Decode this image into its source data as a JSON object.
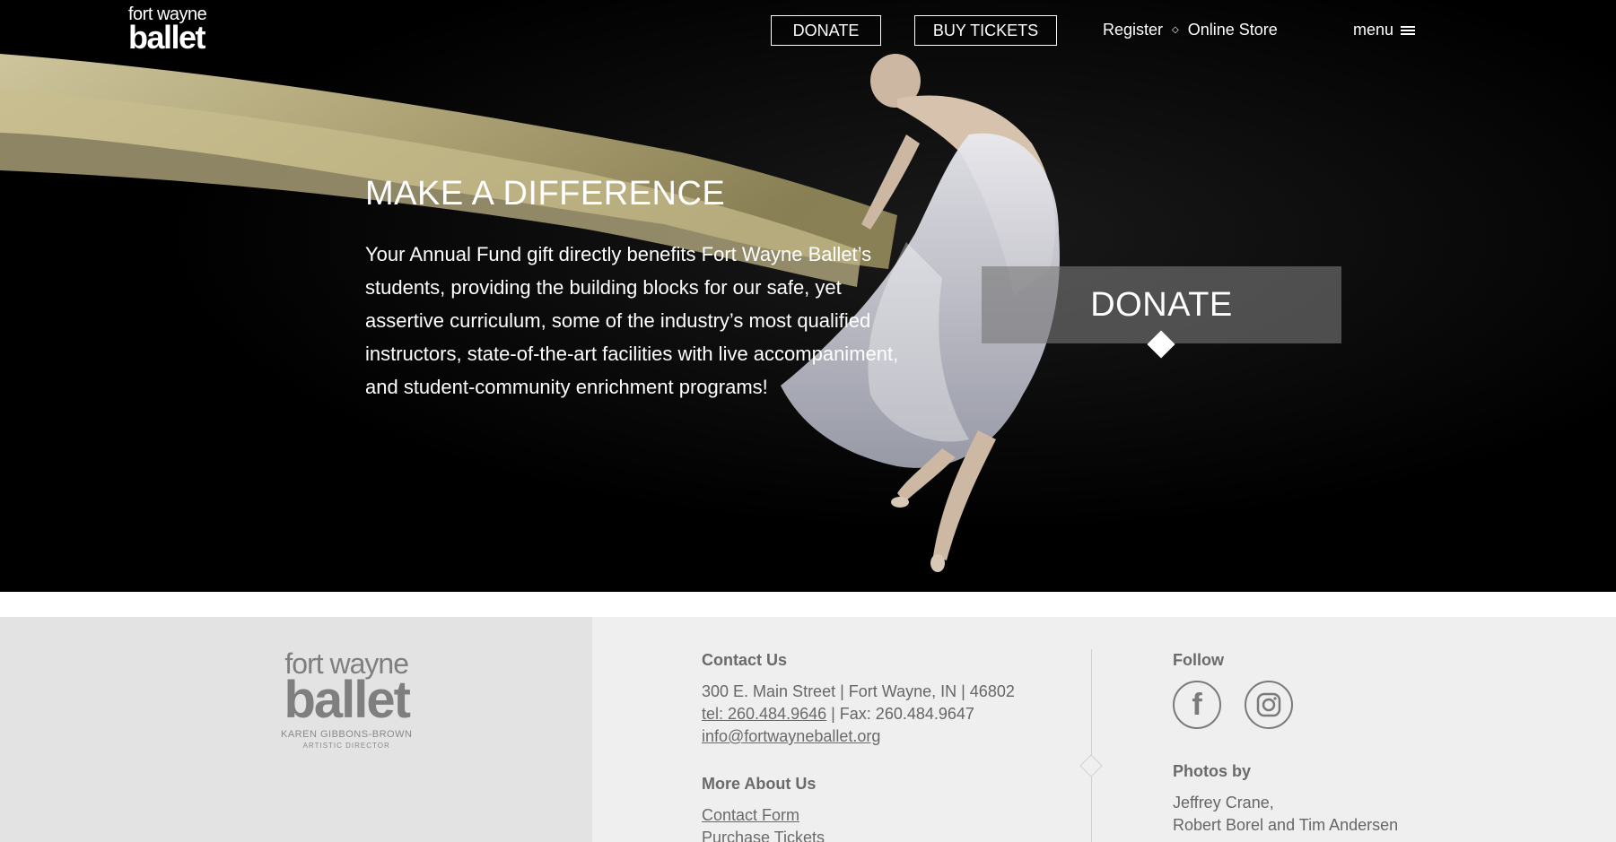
{
  "header": {
    "logo_small": "fort wayne",
    "logo_big": "ballet",
    "donate": "DONATE",
    "buy_tickets": "BUY TICKETS",
    "register": "Register",
    "separator": "◇",
    "online_store": "Online Store",
    "menu": "menu"
  },
  "hero": {
    "title": "MAKE A DIFFERENCE",
    "text": "Your Annual Fund gift directly benefits Fort Wayne Ballet’s students, providing the building blocks for our safe, yet assertive curriculum, some of the industry’s most qualified instructors, state-of-the-art facilities with live accompaniment, and student-community enrichment programs!",
    "donate_button": "DONATE"
  },
  "footer": {
    "logo_small": "fort wayne",
    "logo_big": "ballet",
    "logo_director": "KAREN GIBBONS-BROWN",
    "logo_director_title": "ARTISTIC DIRECTOR",
    "contact_heading": "Contact Us",
    "address": "300 E. Main Street | Fort Wayne, IN | 46802",
    "tel": "tel: 260.484.9646",
    "fax": " | Fax: 260.484.9647",
    "email": "info@fortwayneballet.org",
    "more_heading": "More About Us",
    "more_links": [
      "Contact Form",
      "Purchase Tickets"
    ],
    "follow_heading": "Follow",
    "photos_heading": "Photos by",
    "photos_line1": "Jeffrey Crane,",
    "photos_line2": "Robert Borel and Tim Andersen"
  },
  "icons": [
    "facebook-icon",
    "instagram-icon",
    "menu-icon"
  ],
  "colors": {
    "hero_bg": "#000000",
    "footer_bg": "#efefef",
    "footer_left_bg": "#e3e3e3",
    "text_gray": "#666666"
  }
}
